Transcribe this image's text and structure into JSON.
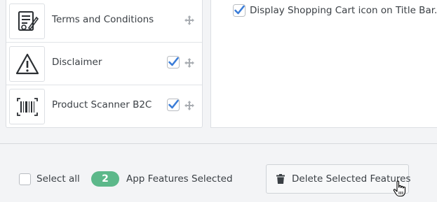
{
  "features": [
    {
      "label": "Terms and Conditions",
      "icon": "contract-signature-icon",
      "checked": false
    },
    {
      "label": "Disclaimer",
      "icon": "warning-triangle-icon",
      "checked": true
    },
    {
      "label": "Product Scanner B2C",
      "icon": "barcode-scanner-icon",
      "checked": true
    }
  ],
  "options": {
    "cart_icon_label": "Display Shopping Cart icon on Title Bar.",
    "cart_icon_checked": true
  },
  "footer": {
    "select_all_label": "Select all",
    "selected_count": "2",
    "selected_label": "App Features Selected",
    "delete_label": "Delete Selected Features"
  },
  "colors": {
    "accent_check": "#3b7dd8",
    "count_badge": "#5cb88a"
  }
}
